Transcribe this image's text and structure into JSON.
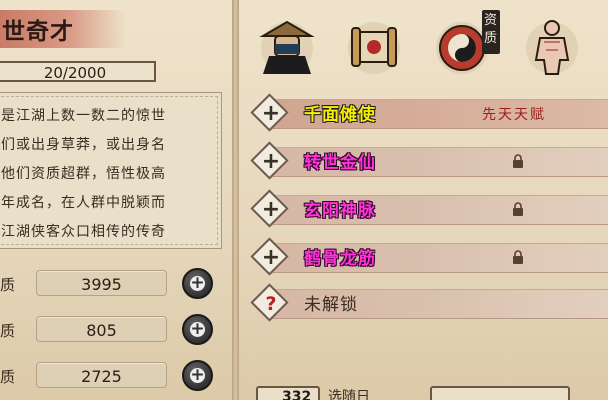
{
  "character": {
    "title": "世奇才",
    "progress_text": "20/2000",
    "description_lines": [
      "是江湖上数一数二的惊世",
      "们或出身草莽，或出身名",
      "他们资质超群，悟性极高",
      "年成名，在人群中脱颖而",
      "江湖侠客众口相传的传奇"
    ]
  },
  "stats": [
    {
      "label": "质",
      "value": "3995",
      "add_label": "+"
    },
    {
      "label": "质",
      "value": "805",
      "add_label": "+"
    },
    {
      "label": "质",
      "value": "2725",
      "add_label": "+"
    }
  ],
  "icons": [
    {
      "name": "swordsman-hat-icon"
    },
    {
      "name": "scroll-icon"
    },
    {
      "name": "yin-yang-icon"
    },
    {
      "name": "meridian-body-icon"
    }
  ],
  "qualification_tag": "资质",
  "talents": [
    {
      "name": "千面傩使",
      "color": "#f6ef00",
      "tag": "先天天赋",
      "locked": false,
      "icon": "plus-icon"
    },
    {
      "name": "转世金仙",
      "color": "#ff33d8",
      "tag": "",
      "locked": true,
      "icon": "plus-icon"
    },
    {
      "name": "玄阳神脉",
      "color": "#ff33d8",
      "tag": "",
      "locked": true,
      "icon": "plus-icon"
    },
    {
      "name": "鹤骨龙筋",
      "color": "#ff33d8",
      "tag": "",
      "locked": true,
      "icon": "plus-icon"
    },
    {
      "name": "未解锁",
      "color": "#3a2c22",
      "tag": "",
      "locked": false,
      "icon": "question-icon"
    }
  ],
  "bottom": {
    "count": "332",
    "label": "选随日"
  }
}
